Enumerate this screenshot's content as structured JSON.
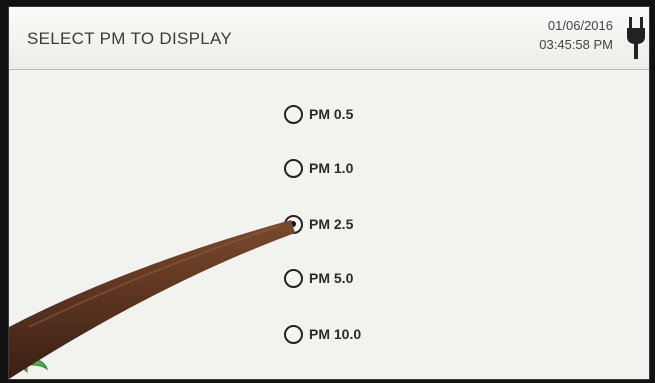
{
  "header": {
    "title": "SELECT PM TO DISPLAY",
    "date": "01/06/2016",
    "time": "03:45:58 PM",
    "power_icon": "plug-icon"
  },
  "options": [
    {
      "label": "PM 0.5",
      "checked": false
    },
    {
      "label": "PM 1.0",
      "checked": false
    },
    {
      "label": "PM 2.5",
      "checked": true
    },
    {
      "label": "PM 5.0",
      "checked": false
    },
    {
      "label": "PM 10.0",
      "checked": false
    }
  ],
  "footer": {
    "back_icon": "back-arrow-icon"
  },
  "colors": {
    "screen_bg": "#f2f2ee",
    "back_arrow": "#4caf50"
  }
}
